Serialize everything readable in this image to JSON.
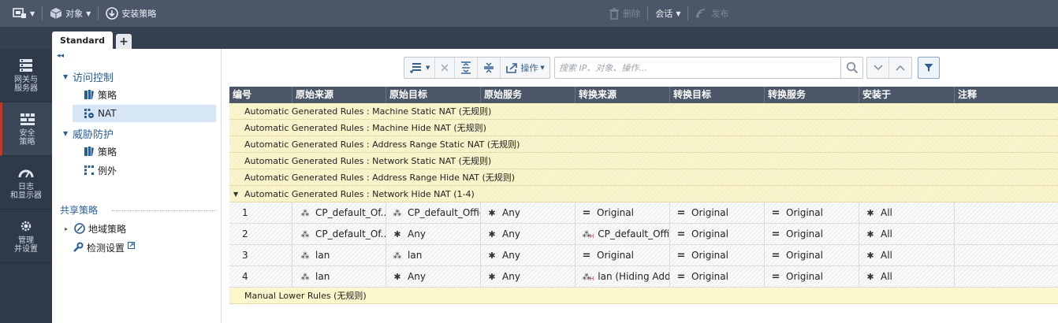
{
  "topbar": {
    "objects_label": "对象",
    "install_label": "安装策略",
    "delete_label": "删除",
    "session_label": "会话",
    "publish_label": "发布"
  },
  "tabs": {
    "active_label": "Standard",
    "add_label": "+"
  },
  "leftnav": {
    "items": [
      {
        "label1": "网关与",
        "label2": "服务器",
        "icon": "gateways-servers-icon"
      },
      {
        "label1": "安全",
        "label2": "策略",
        "icon": "security-policies-icon"
      },
      {
        "label1": "日志",
        "label2": "和显示器",
        "icon": "logs-monitor-icon"
      },
      {
        "label1": "管理",
        "label2": "并设置",
        "icon": "manage-settings-icon"
      }
    ]
  },
  "tree": {
    "access_control": "访问控制",
    "ac_policy": "策略",
    "ac_nat": "NAT",
    "threat_prevention": "威胁防护",
    "tp_policy": "策略",
    "tp_exceptions": "例外",
    "shared_policies": "共享策略",
    "geo_policy": "地域策略",
    "inspection_settings": "检测设置"
  },
  "maintoolbar": {
    "actions_label": "操作",
    "search_placeholder": "搜索 IP、对象、操作..."
  },
  "table": {
    "columns": [
      "编号",
      "原始来源",
      "原始目标",
      "原始服务",
      "转换来源",
      "转换目标",
      "转换服务",
      "安装于",
      "注释"
    ],
    "sections": [
      "Automatic Generated Rules : Machine Static NAT (无规则)",
      "Automatic Generated Rules : Machine Hide NAT (无规则)",
      "Automatic Generated Rules : Address Range Static NAT (无规则)",
      "Automatic Generated Rules : Network Static NAT (无规则)",
      "Automatic Generated Rules : Address Range Hide NAT (无规则)"
    ],
    "expanded_section": "Automatic Generated Rules : Network Hide NAT (1-4)",
    "rows": [
      {
        "no": "1",
        "orig_src": "CP_default_Of...",
        "orig_dst": "CP_default_Offic",
        "orig_svc": "Any",
        "xlt_src": "Original",
        "xlt_dst": "Original",
        "xlt_svc": "Original",
        "install_on": "All",
        "src_icon": "network",
        "dst_icon": "network",
        "xsrc_icon": "equal"
      },
      {
        "no": "2",
        "orig_src": "CP_default_Of...",
        "orig_dst": "Any",
        "orig_svc": "Any",
        "xlt_src": "CP_default_Offic",
        "xlt_dst": "Original",
        "xlt_svc": "Original",
        "install_on": "All",
        "src_icon": "network",
        "dst_icon": "any",
        "xsrc_icon": "network-hide"
      },
      {
        "no": "3",
        "orig_src": "lan",
        "orig_dst": "lan",
        "orig_svc": "Any",
        "xlt_src": "Original",
        "xlt_dst": "Original",
        "xlt_svc": "Original",
        "install_on": "All",
        "src_icon": "network",
        "dst_icon": "network",
        "xsrc_icon": "equal"
      },
      {
        "no": "4",
        "orig_src": "lan",
        "orig_dst": "Any",
        "orig_svc": "Any",
        "xlt_src": "lan (Hiding Add",
        "xlt_dst": "Original",
        "xlt_svc": "Original",
        "install_on": "All",
        "src_icon": "network",
        "dst_icon": "any",
        "xsrc_icon": "network-hide"
      }
    ],
    "manual_section": "Manual Lower Rules (无规则)"
  },
  "colors": {
    "topbar_bg": "#4b5769",
    "nav_bg": "#2e3a49",
    "section_bg": "#f9f5cf",
    "link_blue": "#2a5d94"
  }
}
